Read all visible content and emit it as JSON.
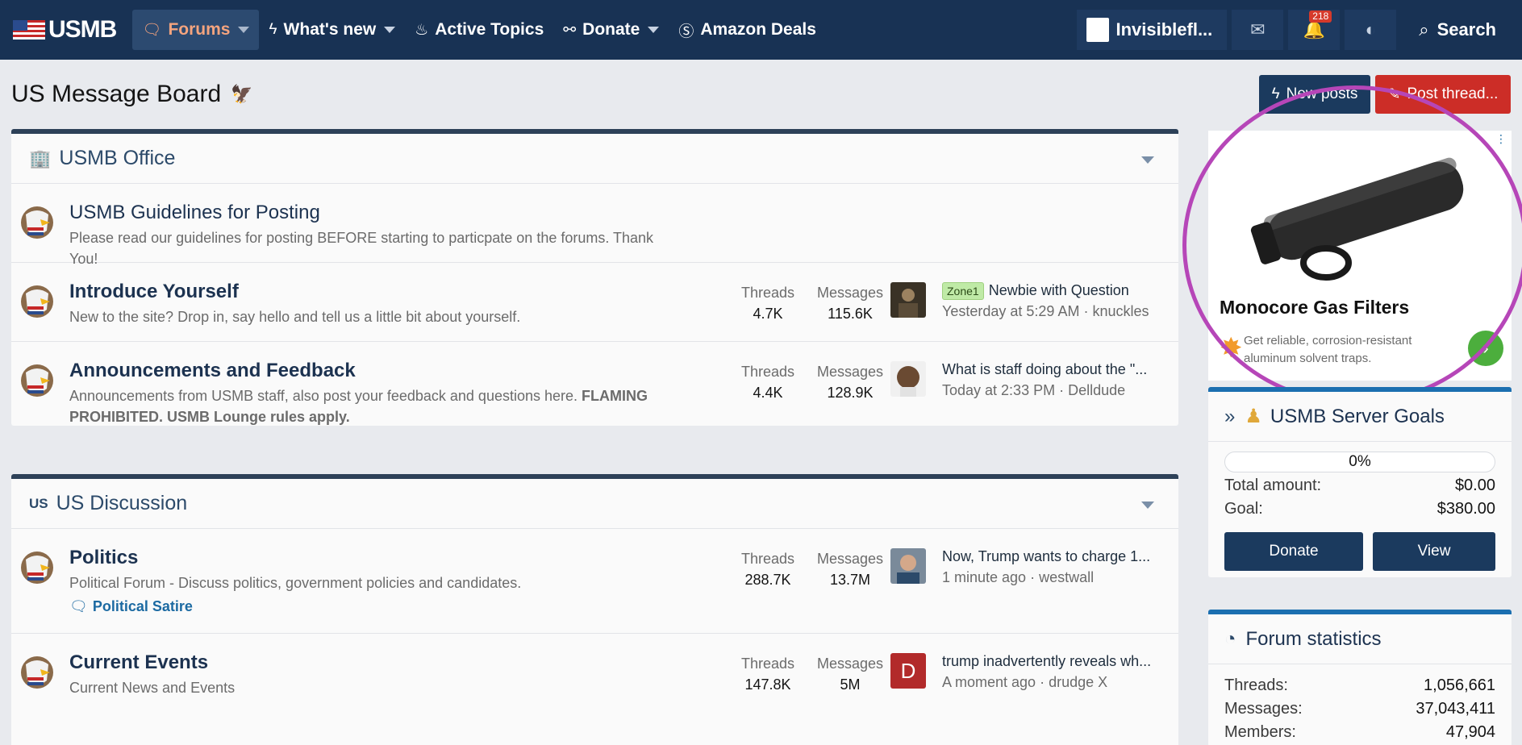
{
  "nav": {
    "logo": "USMB",
    "tabs": [
      {
        "label": "Forums",
        "icon": "chat-icon",
        "has_menu": true,
        "selected": true
      },
      {
        "label": "What's new",
        "icon": "bolt-icon",
        "has_menu": true,
        "selected": false
      },
      {
        "label": "Active Topics",
        "icon": "fire-icon",
        "has_menu": false,
        "selected": false
      },
      {
        "label": "Donate",
        "icon": "handshake-icon",
        "has_menu": true,
        "selected": false
      },
      {
        "label": "Amazon Deals",
        "icon": "dollar-icon",
        "has_menu": false,
        "selected": false
      }
    ],
    "user": "Invisiblefl...",
    "alerts_badge": "218",
    "search_label": "Search"
  },
  "page": {
    "title": "US Message Board",
    "new_posts_label": "New posts",
    "post_thread_label": "Post thread..."
  },
  "categories": [
    {
      "title": "USMB Office",
      "nodes": [
        {
          "title": "USMB Guidelines for Posting",
          "desc": "Please read our guidelines for posting BEFORE starting to particpate on the forums. Thank You!"
        },
        {
          "title": "Introduce Yourself",
          "desc": "New to the site? Drop in, say hello and tell us a little bit about yourself.",
          "threads_label": "Threads",
          "threads": "4.7K",
          "messages_label": "Messages",
          "messages": "115.6K",
          "last_prefix": "Zone1",
          "last_title": "Newbie with Question",
          "last_time": "Yesterday at 5:29 AM",
          "last_user": "knuckles"
        },
        {
          "title": "Announcements and Feedback",
          "desc": "Announcements from USMB staff, also post your feedback and questions here.",
          "desc_bold": "FLAMING PROHIBITED. USMB Lounge rules apply.",
          "threads_label": "Threads",
          "threads": "4.4K",
          "messages_label": "Messages",
          "messages": "128.9K",
          "last_title": "What is staff doing about the \"...",
          "last_time": "Today at 2:33 PM",
          "last_user": "Delldude"
        }
      ]
    },
    {
      "title": "US Discussion",
      "flag_text": "US",
      "nodes": [
        {
          "title": "Politics",
          "desc": "Political Forum - Discuss politics, government policies and candidates.",
          "subforum": "Political Satire",
          "threads_label": "Threads",
          "threads": "288.7K",
          "messages_label": "Messages",
          "messages": "13.7M",
          "last_title": "Now, Trump wants to charge 1...",
          "last_time": "1 minute ago",
          "last_user": "westwall"
        },
        {
          "title": "Current Events",
          "desc": "Current News and Events",
          "threads_label": "Threads",
          "threads": "147.8K",
          "messages_label": "Messages",
          "messages": "5M",
          "last_title": "trump inadvertently reveals wh...",
          "last_time": "A moment ago",
          "last_user": "drudge X",
          "last_avatar_letter": "D"
        }
      ]
    }
  ],
  "ad": {
    "title": "Monocore Gas Filters",
    "text": "Get reliable, corrosion-resistant aluminum solvent traps."
  },
  "goals": {
    "title": "USMB Server Goals",
    "progress": 0,
    "progress_label": "0%",
    "total_label": "Total amount:",
    "total": "$0.00",
    "goal_label": "Goal:",
    "goal": "$380.00",
    "donate_label": "Donate",
    "view_label": "View"
  },
  "stats": {
    "title": "Forum statistics",
    "threads_label": "Threads:",
    "threads": "1,056,661",
    "messages_label": "Messages:",
    "messages": "37,043,411",
    "members_label": "Members:",
    "members": "47,904"
  },
  "colors": {
    "nav_bg": "#183254",
    "accent_red": "#cc2d27",
    "highlight_ring": "#b646b8"
  }
}
